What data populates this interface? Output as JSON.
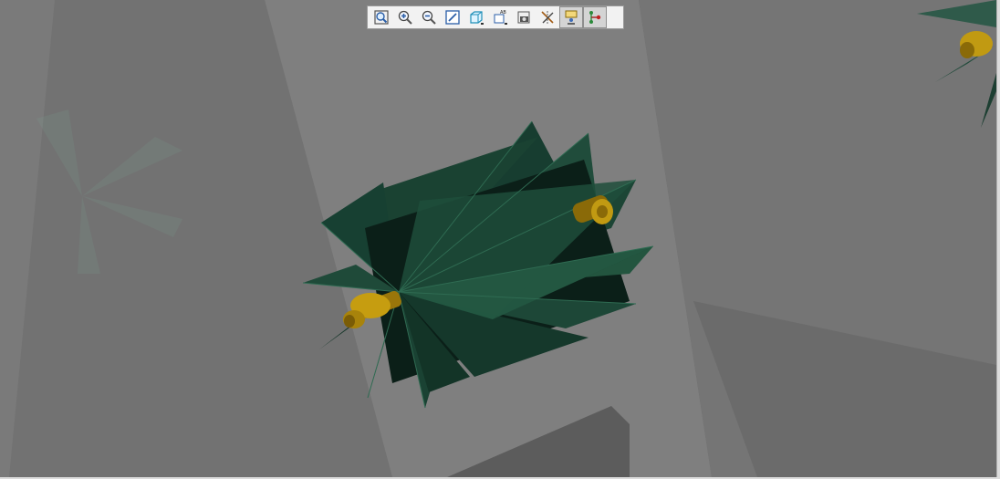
{
  "viewer": {
    "scene_description_hidden": "",
    "colors": {
      "background": "#6a6a6a",
      "fin": "#1f4a3a",
      "fin_dark": "#0e2a20",
      "brass": "#b8900c"
    }
  },
  "toolbar": {
    "buttons": [
      {
        "icon": "zoom-fit-icon",
        "active": false
      },
      {
        "icon": "zoom-in-icon",
        "active": false
      },
      {
        "icon": "zoom-out-icon",
        "active": false
      },
      {
        "icon": "sketch-icon",
        "active": false
      },
      {
        "icon": "view-cube-icon",
        "active": false
      },
      {
        "icon": "label-icon",
        "active": false
      },
      {
        "icon": "screenshot-icon",
        "active": false
      },
      {
        "icon": "axes-icon",
        "active": false
      },
      {
        "icon": "presenter-icon",
        "active": true
      },
      {
        "icon": "graph-node-icon",
        "active": true
      }
    ]
  }
}
